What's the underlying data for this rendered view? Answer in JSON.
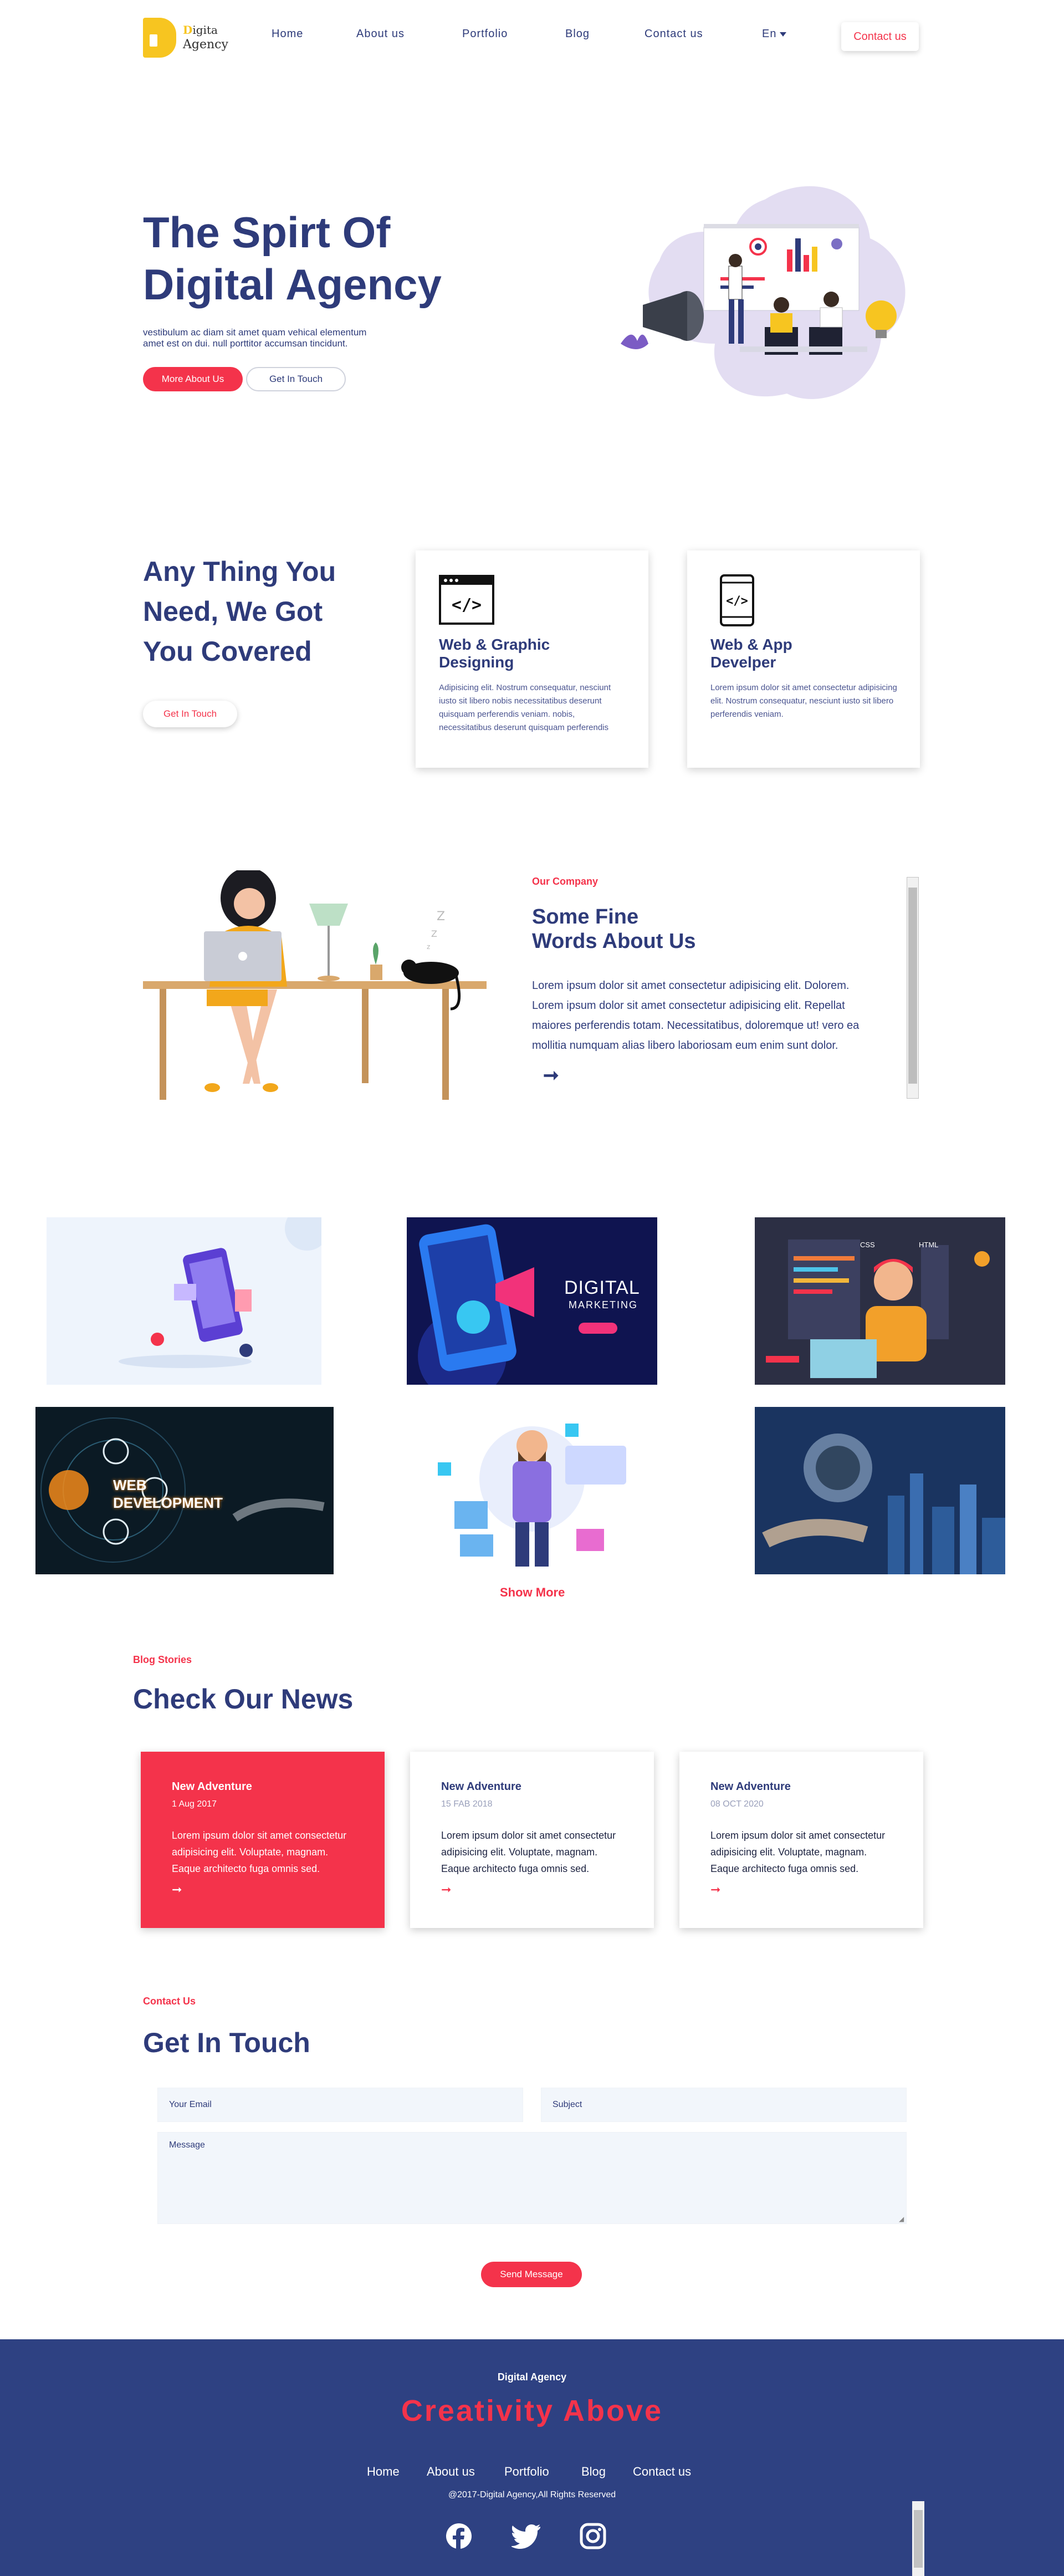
{
  "logo": {
    "line1a": "D",
    "line1b": "igita",
    "line2": "Agency"
  },
  "nav": {
    "items": [
      "Home",
      "About us",
      "Portfolio",
      "Blog",
      "Contact us"
    ],
    "language": "En",
    "contact_button": "Contact us"
  },
  "hero": {
    "title_line1": "The Spirt Of",
    "title_line2": "Digital Agency",
    "subtitle_line1": "vestibulum ac diam sit amet quam vehical elementum",
    "subtitle_line2": "amet est on dui. null porttitor accumsan tincidunt.",
    "primary_button": "More About Us",
    "secondary_button": "Get In Touch"
  },
  "services": {
    "title_line1": "Any Thing You",
    "title_line2": "Need, We Got",
    "title_line3": "You Covered",
    "button": "Get In Touch",
    "cards": [
      {
        "icon": "code-window-icon",
        "title_line1": "Web & Graphic",
        "title_line2": "Designing",
        "text": "Adipisicing elit. Nostrum consequatur, nesciunt iusto sit libero nobis necessitatibus deserunt quisquam perferendis veniam. nobis, necessitatibus deserunt quisquam perferendis"
      },
      {
        "icon": "mobile-code-icon",
        "title_line1": "Web & App",
        "title_line2": "Develper",
        "text": "Lorem ipsum dolor sit amet consectetur adipisicing elit. Nostrum consequatur, nesciunt iusto sit libero perferendis veniam."
      }
    ]
  },
  "about": {
    "tag": "Our Company",
    "title_line1": "Some Fine",
    "title_line2": "Words About Us",
    "text": "Lorem ipsum dolor sit amet consectetur adipisicing elit. Dolorem. Lorem ipsum dolor sit amet consectetur adipisicing elit. Repellat maiores perferendis totam. Necessitatibus, doloremque ut! vero ea mollitia numquam alias libero laboriosam eum enim sunt dolor.",
    "arrow": "➞"
  },
  "portfolio": {
    "tile2_line1": "DIGITAL",
    "tile2_line2": "MARKETING",
    "tile4_line1": "WEB",
    "tile4_line2": "DEVELOPMENT",
    "tile3_css": "CSS",
    "tile3_html": "HTML",
    "show_more": "Show More"
  },
  "news": {
    "tag": "Blog Stories",
    "title": "Check Our News",
    "cards": [
      {
        "title": "New Adventure",
        "date": "1 Aug 2017",
        "text": "Lorem ipsum dolor sit amet consectetur adipisicing elit. Voluptate, magnam. Eaque architecto fuga omnis sed.",
        "arrow": "➞"
      },
      {
        "title": "New Adventure",
        "date": "15 FAB 2018",
        "text": "Lorem ipsum dolor sit amet consectetur adipisicing elit. Voluptate, magnam. Eaque architecto fuga omnis sed.",
        "arrow": "➞"
      },
      {
        "title": "New Adventure",
        "date": "08 OCT 2020",
        "text": "Lorem ipsum dolor sit amet consectetur adipisicing elit. Voluptate, magnam. Eaque architecto fuga omnis sed.",
        "arrow": "➞"
      }
    ]
  },
  "contact": {
    "tag": "Contact Us",
    "title": "Get In Touch",
    "email_placeholder": "Your Email",
    "subject_placeholder": "Subject",
    "message_placeholder": "Message",
    "send_button": "Send Message"
  },
  "footer": {
    "brand": "Digital Agency",
    "slogan": "Creativity Above",
    "nav": [
      "Home",
      "About us",
      "Portfolio",
      "Blog",
      "Contact us"
    ],
    "copyright": "@2017-Digital Agency,All Rights Reserved",
    "social": [
      "facebook-icon",
      "twitter-icon",
      "instagram-icon"
    ]
  },
  "colors": {
    "navy": "#2e3b7a",
    "red": "#f4334b",
    "footer": "#2e4182",
    "accent_yellow": "#f7c520"
  }
}
